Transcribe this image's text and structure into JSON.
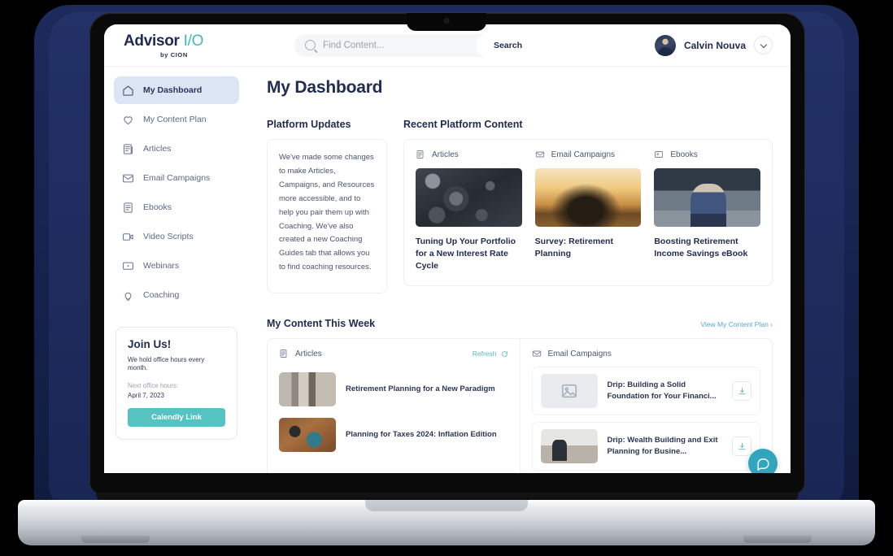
{
  "header": {
    "logo_main": "Advisor",
    "logo_io": "I/O",
    "logo_sub": "by CION",
    "search_placeholder": "Find Content...",
    "search_value": "",
    "search_button": "Search",
    "user_name": "Calvin Nouva"
  },
  "sidebar": {
    "items": [
      {
        "label": "My Dashboard",
        "icon": "home-icon"
      },
      {
        "label": "My Content Plan",
        "icon": "heart-icon"
      },
      {
        "label": "Articles",
        "icon": "article-icon"
      },
      {
        "label": "Email Campaigns",
        "icon": "envelope-icon"
      },
      {
        "label": "Ebooks",
        "icon": "ebook-icon"
      },
      {
        "label": "Video Scripts",
        "icon": "video-icon"
      },
      {
        "label": "Webinars",
        "icon": "webinar-icon"
      },
      {
        "label": "Coaching",
        "icon": "lightbulb-icon"
      }
    ],
    "join_card": {
      "title": "Join Us!",
      "subtitle": "We hold office hours every month.",
      "next_label": "Next office hours:",
      "next_date": "April 7, 2023",
      "button": "Calendly Link"
    }
  },
  "main": {
    "page_title": "My Dashboard",
    "platform_updates": {
      "heading": "Platform Updates",
      "body": "We've made some changes to make Articles, Campaigns, and Resources more accessible, and to help you pair them up with Coaching. We've also created a new Coaching Guides tab that allows you to find coaching resources."
    },
    "recent_platform_content": {
      "heading": "Recent Platform Content",
      "columns": [
        {
          "label": "Articles",
          "icon": "article-icon",
          "title": "Tuning Up Your Portfolio for a New Interest Rate Cycle"
        },
        {
          "label": "Email Campaigns",
          "icon": "envelope-icon",
          "title": "Survey: Retirement Planning"
        },
        {
          "label": "Ebooks",
          "icon": "ebook-icon",
          "title": "Boosting Retirement Income Savings eBook"
        }
      ]
    },
    "my_content_this_week": {
      "heading": "My Content This Week",
      "view_plan_link": "View My Content Plan ›",
      "articles": {
        "label": "Articles",
        "icon": "article-icon",
        "refresh_label": "Refresh",
        "items": [
          {
            "title": "Retirement Planning for a New Paradigm"
          },
          {
            "title": "Planning for Taxes 2024: Inflation Edition"
          }
        ]
      },
      "email_campaigns": {
        "label": "Email Campaigns",
        "icon": "envelope-icon",
        "items": [
          {
            "title": "Drip: Building a Solid Foundation for Your Financi..."
          },
          {
            "title": "Drip: Wealth Building and Exit Planning for Busine..."
          }
        ]
      }
    }
  },
  "chat": {
    "icon": "chat-bubble-icon"
  },
  "colors": {
    "navy": "#222c52",
    "teal": "#56c2c2",
    "chat_teal": "#30a5bd",
    "active_nav": "#dbe5f3",
    "link_blue": "#5aa9c9"
  }
}
